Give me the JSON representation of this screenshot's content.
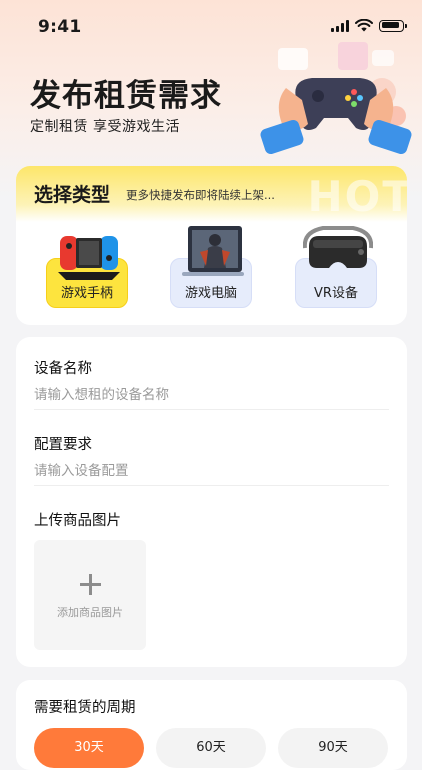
{
  "status_bar": {
    "time": "9:41"
  },
  "header": {
    "title": "发布租赁需求",
    "subtitle": "定制租赁 享受游戏生活"
  },
  "type_section": {
    "title": "选择类型",
    "hint": "更多快捷发布即将陆续上架...",
    "badge": "HOT",
    "items": [
      {
        "label": "游戏手柄",
        "icon": "game-controller-icon",
        "selected": true
      },
      {
        "label": "游戏电脑",
        "icon": "gaming-pc-icon",
        "selected": false
      },
      {
        "label": "VR设备",
        "icon": "vr-headset-icon",
        "selected": false
      }
    ]
  },
  "form": {
    "device_name": {
      "label": "设备名称",
      "placeholder": "请输入想租的设备名称",
      "value": ""
    },
    "config": {
      "label": "配置要求",
      "placeholder": "请输入设备配置",
      "value": ""
    },
    "upload": {
      "label": "上传商品图片",
      "button_text": "添加商品图片"
    }
  },
  "period": {
    "title": "需要租赁的周期",
    "options": [
      {
        "label": "30天",
        "selected": true
      },
      {
        "label": "60天",
        "selected": false
      },
      {
        "label": "90天",
        "selected": false
      }
    ]
  },
  "colors": {
    "accent_orange": "#ff7a3a",
    "highlight_yellow": "#fde43e",
    "option_blue": "#e6ecfb"
  }
}
